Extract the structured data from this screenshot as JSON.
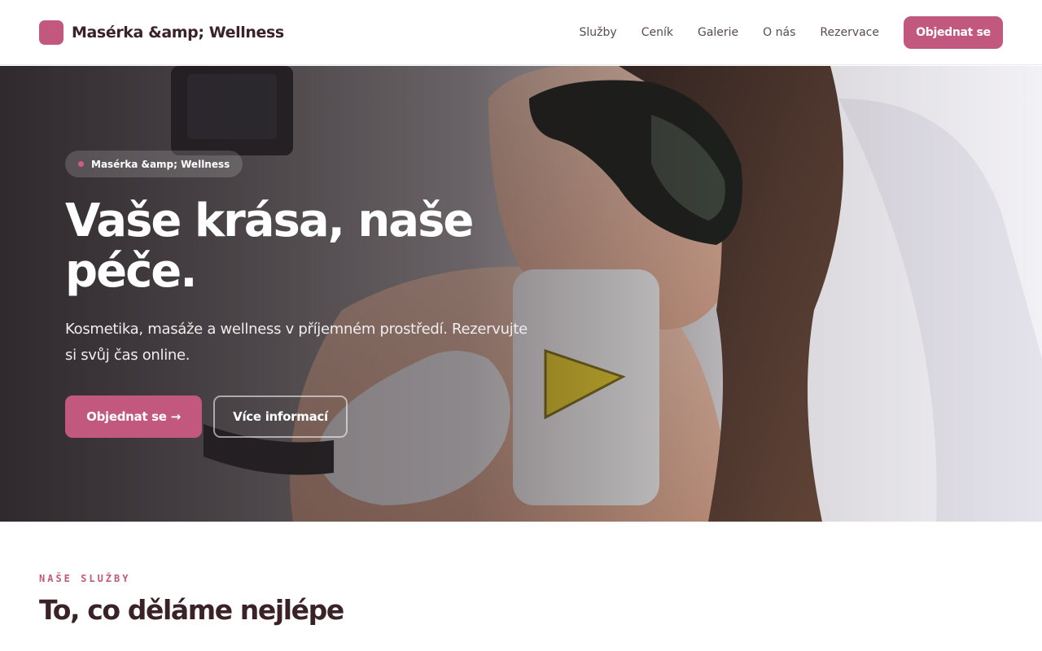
{
  "brand": {
    "name": "Masérka &amp; Wellness",
    "accent_color": "#c2587d",
    "logo_icon": "rounded-square-logo"
  },
  "nav": {
    "items": [
      "Služby",
      "Ceník",
      "Galerie",
      "O nás",
      "Rezervace"
    ],
    "cta_label": "Objednat se"
  },
  "hero": {
    "badge": "Masérka &amp; Wellness",
    "title_line1": "Vaše krása, naše",
    "title_line2": "péče.",
    "subtitle": "Kosmetika, masáže a wellness v příjemném prostředí. Rezervujte si svůj čas online.",
    "primary_button": "Objednat se →",
    "secondary_button": "Více informací",
    "image_subject": "laser-hair-removal-treatment-photo"
  },
  "services": {
    "eyebrow": "NAŠE SLUŽBY",
    "title": "To, co děláme nejlépe"
  }
}
